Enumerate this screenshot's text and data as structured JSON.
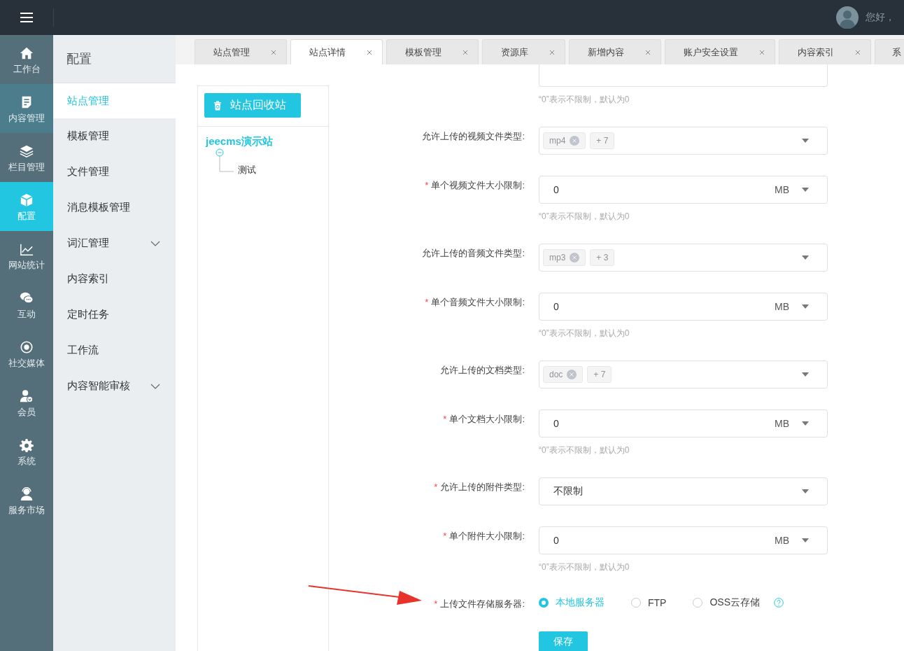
{
  "topbar": {
    "greeting": "您好，"
  },
  "rail": [
    {
      "label": "工作台",
      "selected": false,
      "hovered": false
    },
    {
      "label": "内容管理",
      "selected": false,
      "hovered": true
    },
    {
      "label": "栏目管理",
      "selected": false,
      "hovered": false
    },
    {
      "label": "配置",
      "selected": true,
      "hovered": false
    },
    {
      "label": "网站统计",
      "selected": false,
      "hovered": false
    },
    {
      "label": "互动",
      "selected": false,
      "hovered": false
    },
    {
      "label": "社交媒体",
      "selected": false,
      "hovered": false
    },
    {
      "label": "会员",
      "selected": false,
      "hovered": false
    },
    {
      "label": "系统",
      "selected": false,
      "hovered": false
    },
    {
      "label": "服务市场",
      "selected": false,
      "hovered": false
    }
  ],
  "submenu": {
    "title": "配置",
    "items": [
      {
        "label": "站点管理",
        "selected": true,
        "expandable": false
      },
      {
        "label": "模板管理",
        "selected": false,
        "expandable": false
      },
      {
        "label": "文件管理",
        "selected": false,
        "expandable": false
      },
      {
        "label": "消息模板管理",
        "selected": false,
        "expandable": false
      },
      {
        "label": "词汇管理",
        "selected": false,
        "expandable": true
      },
      {
        "label": "内容索引",
        "selected": false,
        "expandable": false
      },
      {
        "label": "定时任务",
        "selected": false,
        "expandable": false
      },
      {
        "label": "工作流",
        "selected": false,
        "expandable": false
      },
      {
        "label": "内容智能审核",
        "selected": false,
        "expandable": true
      }
    ]
  },
  "tabs": [
    {
      "label": "站点管理",
      "selected": false
    },
    {
      "label": "站点详情",
      "selected": true
    },
    {
      "label": "模板管理",
      "selected": false
    },
    {
      "label": "资源库",
      "selected": false
    },
    {
      "label": "新增内容",
      "selected": false
    },
    {
      "label": "账户安全设置",
      "selected": false
    },
    {
      "label": "内容索引",
      "selected": false
    },
    {
      "label": "系",
      "selected": false
    }
  ],
  "tree": {
    "button": "站点回收站",
    "root": {
      "label": "jeecms演示站",
      "expanded": true,
      "children": [
        {
          "label": "测试"
        }
      ]
    }
  },
  "form": {
    "fields": [
      {
        "kind": "partial",
        "hint": "“0”表示不限制，默认为0"
      },
      {
        "kind": "tags",
        "label": "允许上传的视频文件类型:",
        "tags": [
          {
            "label": "mp4",
            "removable": true
          },
          {
            "label": "+ 7",
            "removable": false
          }
        ]
      },
      {
        "kind": "size",
        "label": "单个视频文件大小限制:",
        "required_mark": "*",
        "value": "0",
        "unit": "MB",
        "hint": "“0”表示不限制，默认为0"
      },
      {
        "kind": "tags",
        "label": "允许上传的音频文件类型:",
        "tags": [
          {
            "label": "mp3",
            "removable": true
          },
          {
            "label": "+ 3",
            "removable": false
          }
        ]
      },
      {
        "kind": "size",
        "label": "单个音频文件大小限制:",
        "required_mark": "*",
        "value": "0",
        "unit": "MB",
        "hint": "“0”表示不限制，默认为0"
      },
      {
        "kind": "tags",
        "label": "允许上传的文档类型:",
        "tags": [
          {
            "label": "doc",
            "removable": true
          },
          {
            "label": "+ 7",
            "removable": false
          }
        ]
      },
      {
        "kind": "size",
        "label": "单个文档大小限制:",
        "required_mark": "*",
        "value": "0",
        "unit": "MB",
        "hint": "“0”表示不限制，默认为0"
      },
      {
        "kind": "select",
        "label": "允许上传的附件类型:",
        "required_mark": "*",
        "value": "不限制"
      },
      {
        "kind": "size",
        "label": "单个附件大小限制:",
        "required_mark": "*",
        "value": "0",
        "unit": "MB",
        "hint": "“0”表示不限制，默认为0"
      },
      {
        "kind": "radio",
        "label": "上传文件存储服务器:",
        "required_mark": "*",
        "help": true,
        "options": [
          {
            "label": "本地服务器",
            "selected": true
          },
          {
            "label": "FTP",
            "selected": false
          },
          {
            "label": "OSS云存储",
            "selected": false
          }
        ]
      }
    ],
    "save_button": "保存"
  },
  "annotation_arrow": true
}
